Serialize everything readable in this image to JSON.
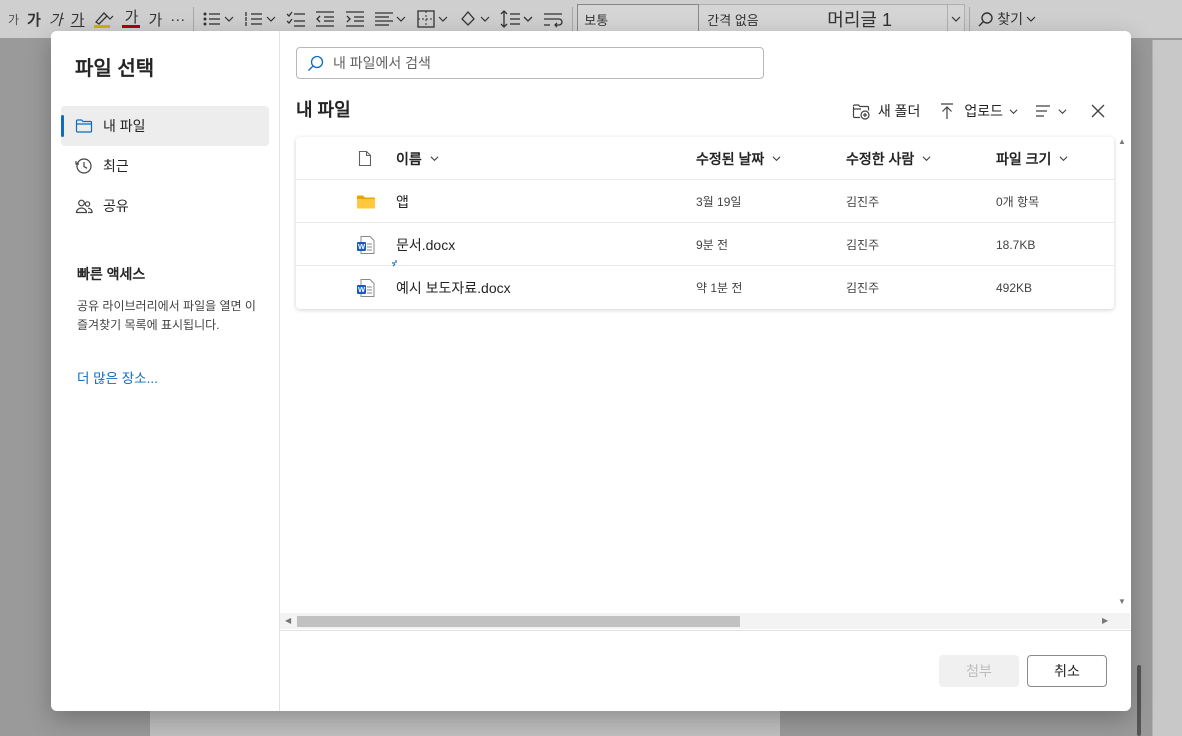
{
  "ribbon": {
    "font_size_label": "가",
    "bold": "가",
    "italic": "가",
    "underline": "가",
    "font_color": "가",
    "clear_format": "가",
    "more": "···",
    "style_normal": "보통",
    "style_no_spacing": "간격 없음",
    "style_heading": "머리글 1",
    "find_label": "찾기"
  },
  "dialog": {
    "title": "파일 선택",
    "nav": [
      {
        "label": "내 파일",
        "icon": "folder-icon",
        "active": true
      },
      {
        "label": "최근",
        "icon": "history-icon",
        "active": false
      },
      {
        "label": "공유",
        "icon": "people-icon",
        "active": false
      }
    ],
    "quick_access": {
      "title": "빠른 액세스",
      "description": "공유 라이브러리에서 파일을 열면 이 즐겨찾기 목록에 표시됩니다.",
      "more_link": "더 많은 장소..."
    },
    "search": {
      "placeholder": "내 파일에서 검색",
      "value": ""
    },
    "main_title": "내 파일",
    "toolbar": {
      "new_folder": "새 폴더",
      "upload": "업로드"
    },
    "columns": {
      "name": "이름",
      "modified": "수정된 날짜",
      "modified_by": "수정한 사람",
      "size": "파일 크기"
    },
    "files": [
      {
        "name": "앱",
        "type": "folder",
        "modified": "3월 19일",
        "modified_by": "김진주",
        "size": "0개 항목"
      },
      {
        "name": "문서.docx",
        "type": "word",
        "modified": "9분 전",
        "modified_by": "김진주",
        "size": "18.7KB"
      },
      {
        "name": "예시 보도자료.docx",
        "type": "word-new",
        "modified": "약 1분 전",
        "modified_by": "김진주",
        "size": "492KB"
      }
    ],
    "buttons": {
      "attach": "첨부",
      "cancel": "취소"
    },
    "colors": {
      "accent": "#0f6cbd",
      "word_blue": "#185abd",
      "folder_yellow": "#ffb900"
    }
  }
}
